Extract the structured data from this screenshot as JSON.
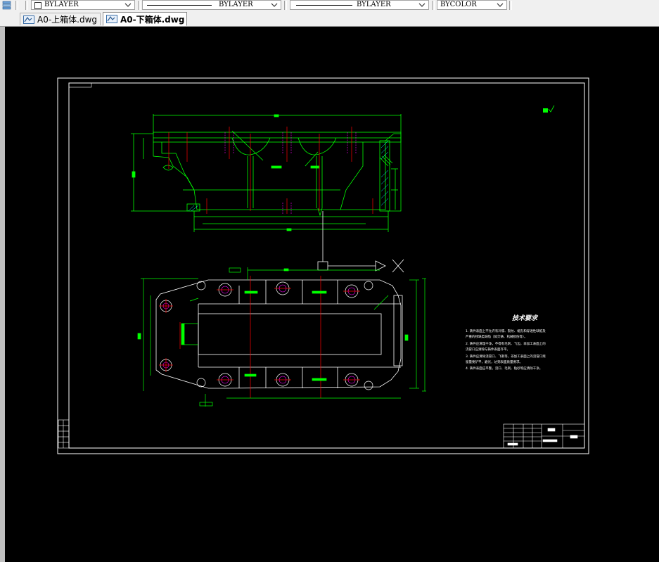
{
  "toolbar": {
    "layer_combo": {
      "value": "BYLAYER"
    },
    "linetype_combo": {
      "value": "BYLAYER"
    },
    "lineweight_combo": {
      "value": "BYLAYER"
    },
    "color_combo": {
      "value": "BYCOLOR"
    }
  },
  "tabs": [
    {
      "label": "A0-上箱体.dwg",
      "active": false,
      "icon": "dwg-file-icon"
    },
    {
      "label": "A0-下箱体.dwg",
      "active": true,
      "icon": "dwg-file-icon"
    }
  ],
  "drawing": {
    "background": "#000000",
    "frame_color": "#ffffff",
    "geometry_color": "#00ff00",
    "centerline_color": "#ff0000",
    "hidden_color": "#ff00ff",
    "tech_requirements": {
      "title": "技术要求",
      "lines": [
        "1. 铸件表面上不允许有冷隔、裂纹、缩孔和穿透性缺陷及",
        "严重的残缺类缺陷（如欠铸、机械损伤等）。",
        "2. 铸件应清理干净，不得有毛刺、飞边，非加工表面上的",
        "浇冒口应清除与铸件表面齐平。",
        "3. 铸件应清除浇冒口、飞刺等，非加工表面上的浇冒口残",
        "留量要铲平，磨光，达到表面质量要求。",
        "4. 铸件表面应平整，浇口、毛刺、粘砂等应清除干净。"
      ]
    }
  }
}
